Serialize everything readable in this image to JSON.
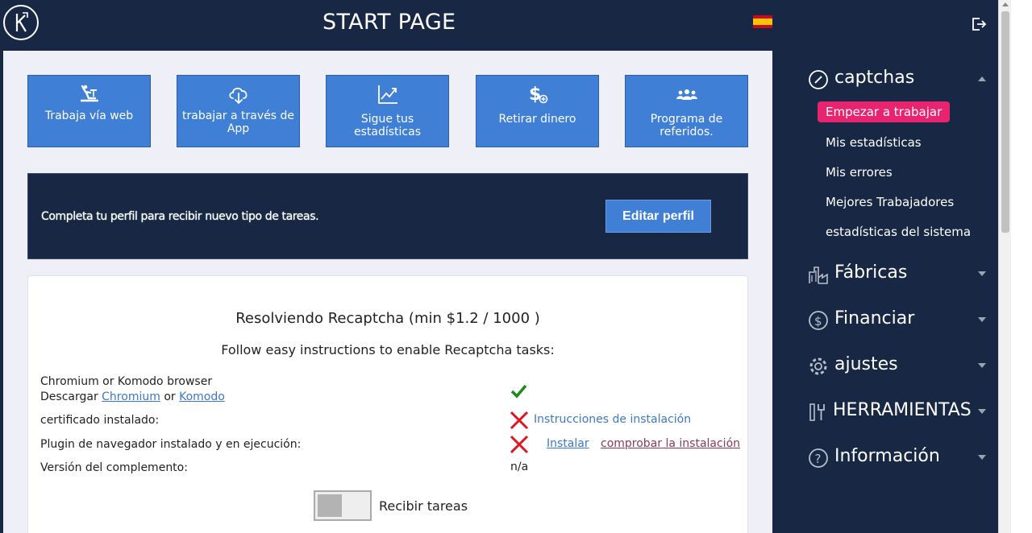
{
  "header": {
    "title": "START PAGE",
    "flag_icon": "spain-flag-icon"
  },
  "tiles": [
    {
      "label": "Trabaja vía web",
      "icon": "worker-icon"
    },
    {
      "label": "trabajar a través de App",
      "icon": "cloud-download-icon"
    },
    {
      "label": "Sigue tus estadísticas",
      "icon": "chart-line-icon"
    },
    {
      "label": "Retirar dinero",
      "icon": "dollar-plus-icon"
    },
    {
      "label": "Programa de referidos.",
      "icon": "users-group-icon"
    }
  ],
  "banner": {
    "text": "Completa tu perfil para recibir nuevo tipo de tareas.",
    "button": "Editar perfil"
  },
  "task_card": {
    "title": "Resolviendo Recaptcha (min $1.2 / 1000 )",
    "subtitle": "Follow easy instructions to enable Recaptcha tasks:",
    "browser_label": "Chromium or Komodo browser",
    "download_prefix": "Descargar",
    "chromium_link": "Chromium",
    "or_word": "or",
    "komodo_link": "Komodo",
    "cert_label": "certificado instalado:",
    "cert_link": "Instrucciones de instalación",
    "plugin_label": "Plugin de navegador instalado y en ejecución:",
    "install_link": "Instalar",
    "check_install_link": "comprobar la instalación",
    "version_label": "Versión del complemento:",
    "version_value": "n/a",
    "toggle_label": "Recibir tareas"
  },
  "sidebar": {
    "sections": [
      {
        "label": "captchas",
        "icon": "gauge-icon",
        "expanded": true
      },
      {
        "label": "Fábricas",
        "icon": "factory-icon",
        "expanded": false
      },
      {
        "label": "Financiar",
        "icon": "dollar-circle-icon",
        "expanded": false
      },
      {
        "label": "ajustes",
        "icon": "gear-icon",
        "expanded": false
      },
      {
        "label": "HERRAMIENTAS",
        "icon": "tools-icon",
        "expanded": false
      },
      {
        "label": "Información",
        "icon": "question-circle-icon",
        "expanded": false
      }
    ],
    "captcha_items": [
      {
        "label": "Empezar a trabajar",
        "active": true
      },
      {
        "label": "Mis estadísticas",
        "active": false
      },
      {
        "label": "Mis errores",
        "active": false
      },
      {
        "label": "Mejores Trabajadores",
        "active": false
      },
      {
        "label": "estadísticas del sistema",
        "active": false
      }
    ]
  },
  "colors": {
    "navy": "#182743",
    "tile_blue": "#3f7fd6",
    "active_pink": "#e8236f",
    "check_green": "#1e8a1e",
    "cross_red": "#e0141e"
  }
}
